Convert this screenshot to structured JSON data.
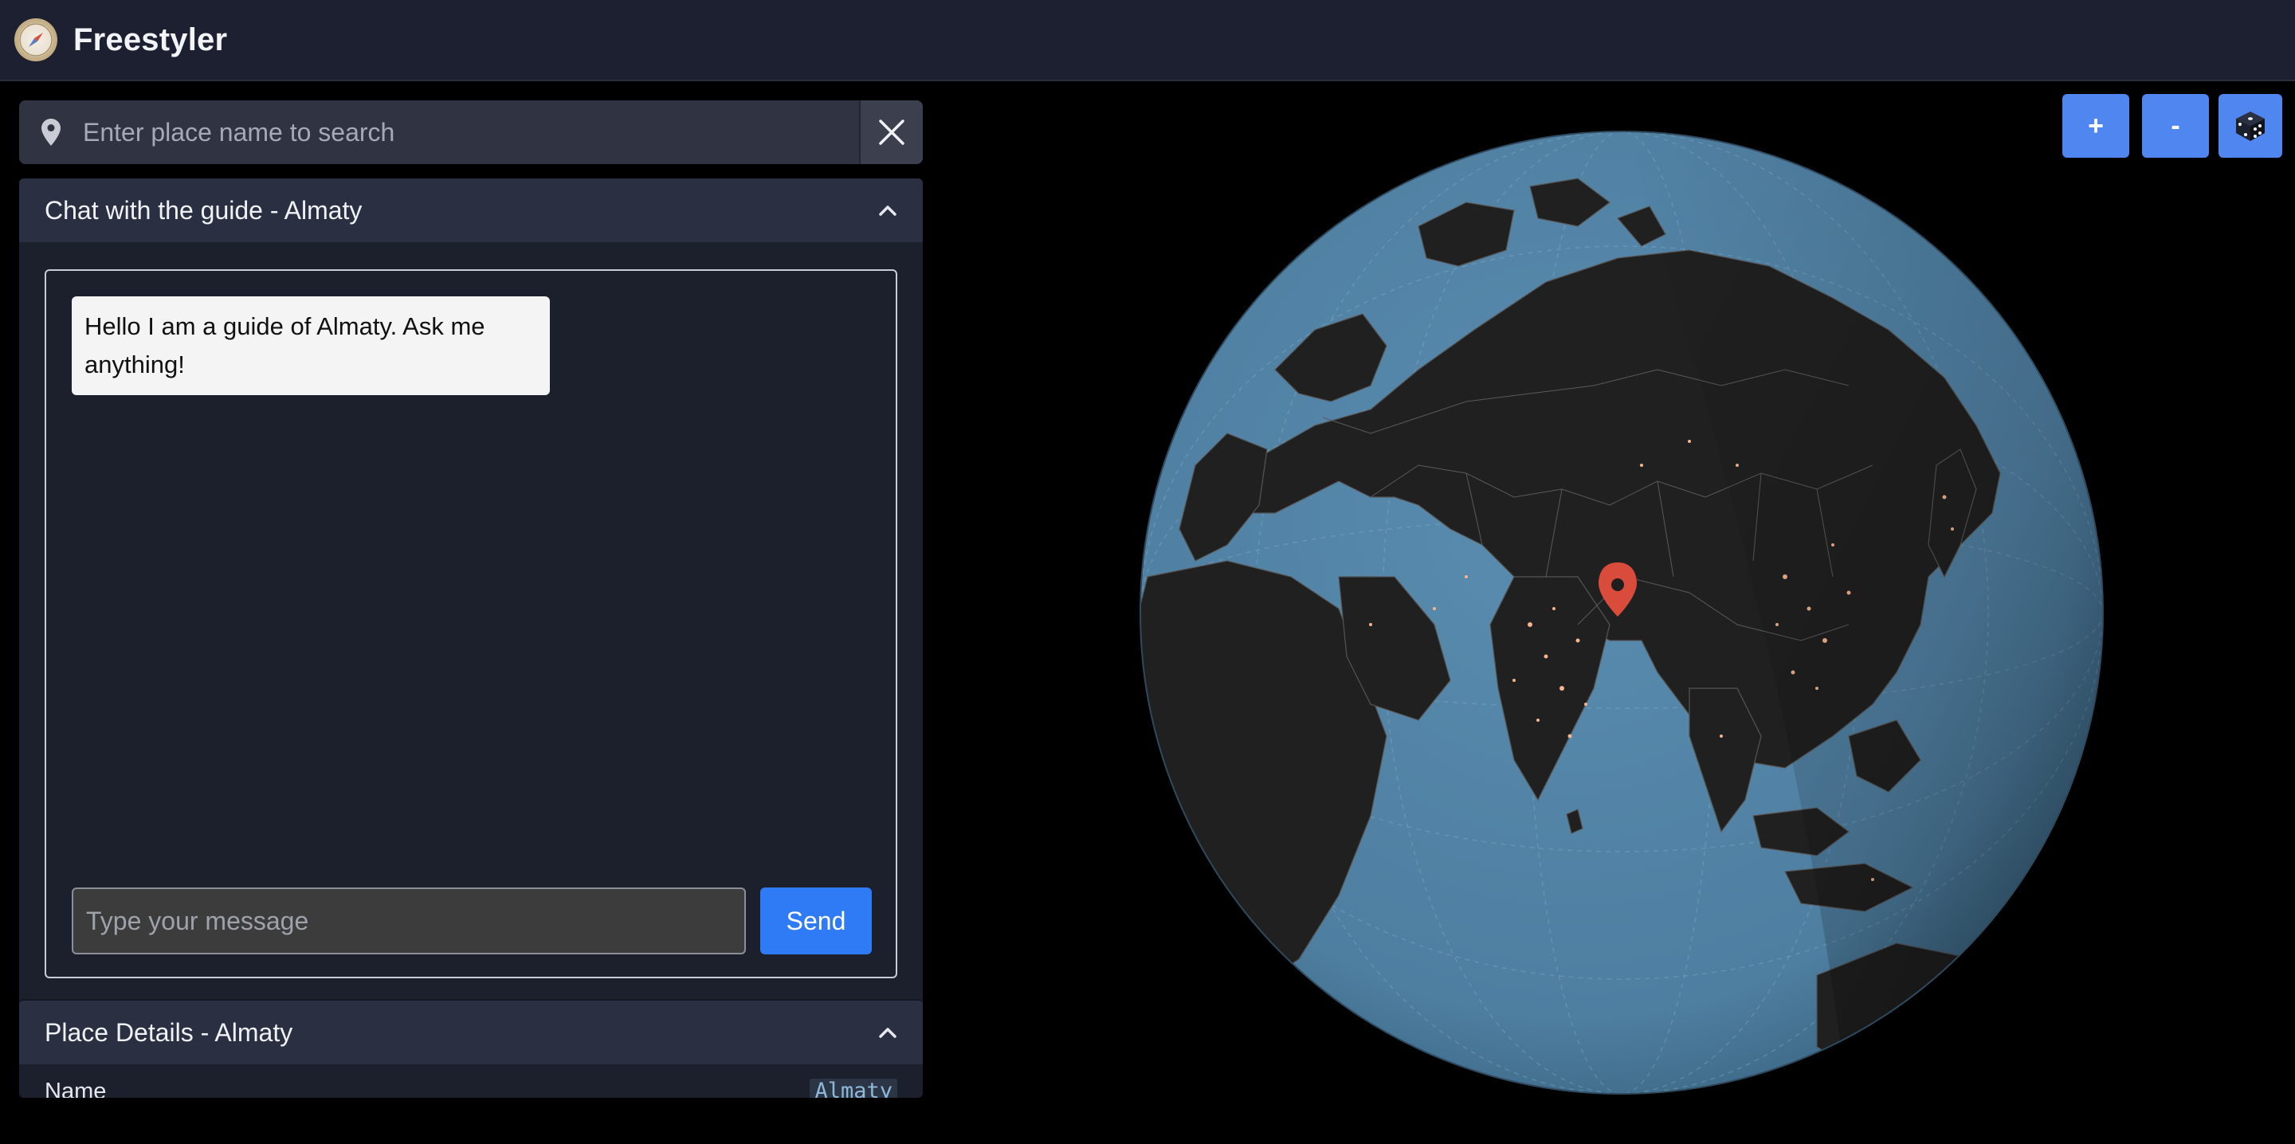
{
  "app": {
    "title": "Freestyler",
    "logo_icon": "compass-icon"
  },
  "search": {
    "placeholder": "Enter place name to search",
    "value": ""
  },
  "chat": {
    "title": "Chat with the guide - Almaty",
    "messages": [
      {
        "from": "guide",
        "text": "Hello I am a guide of Almaty. Ask me anything!"
      }
    ],
    "input_placeholder": "Type your message",
    "send_label": "Send"
  },
  "details": {
    "title": "Place Details - Almaty",
    "rows": [
      {
        "label": "Name",
        "value": "Almaty"
      }
    ]
  },
  "map": {
    "zoom_in_label": "+",
    "zoom_out_label": "-",
    "random_icon": "dice-icon",
    "marker_icon": "map-pin-icon",
    "colors": {
      "ocean": "#4e7ea0",
      "land": "#1f1f1f",
      "marker": "#d94b3a",
      "accent": "#4f86ef"
    }
  }
}
